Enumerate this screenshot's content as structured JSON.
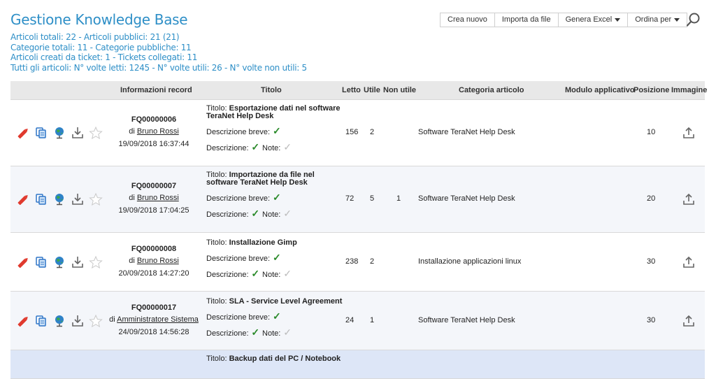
{
  "page": {
    "title": "Gestione Knowledge Base"
  },
  "stats": [
    "Articoli totali: 22 - Articoli pubblici: 21 (21)",
    "Categorie totali: 11 - Categorie pubbliche: 11",
    "Articoli creati da ticket: 1 - Tickets collegati: 11",
    "Tutti gli articoli: N° volte letti: 1245 - N° volte utili: 26 - N° volte non utili: 5"
  ],
  "toolbar": {
    "new_label": "Crea nuovo",
    "import_label": "Importa da file",
    "excel_label": "Genera Excel",
    "sort_label": "Ordina per"
  },
  "table": {
    "headers": {
      "info": "Informazioni record",
      "title": "Titolo",
      "read": "Letto",
      "useful": "Utile",
      "not_useful": "Non utile",
      "category": "Categoria articolo",
      "module": "Modulo applicativo",
      "position": "Posizione",
      "image": "Immagine"
    },
    "labels": {
      "title_prefix": "Titolo:",
      "short_desc": "Descrizione breve:",
      "desc": "Descrizione:",
      "notes": "Note:",
      "by": "di"
    },
    "rows": [
      {
        "code": "FQ00000006",
        "author": "Bruno Rossi",
        "date": "19/09/2018 16:37:44",
        "title": "Esportazione dati nel software TeraNet Help Desk",
        "read": "156",
        "useful": "2",
        "not_useful": "",
        "category": "Software TeraNet Help Desk",
        "position": "10"
      },
      {
        "code": "FQ00000007",
        "author": "Bruno Rossi",
        "date": "19/09/2018 17:04:25",
        "title": "Importazione da file nel software TeraNet Help Desk",
        "read": "72",
        "useful": "5",
        "not_useful": "1",
        "category": "Software TeraNet Help Desk",
        "position": "20"
      },
      {
        "code": "FQ00000008",
        "author": "Bruno Rossi",
        "date": "20/09/2018 14:27:20",
        "title": "Installazione Gimp",
        "read": "238",
        "useful": "2",
        "not_useful": "",
        "category": "Installazione applicazioni linux",
        "position": "30"
      },
      {
        "code": "FQ00000017",
        "author": "Amministratore Sistema",
        "date": "24/09/2018 14:56:28",
        "title": "SLA - Service Level Agreement",
        "read": "24",
        "useful": "1",
        "not_useful": "",
        "category": "Software TeraNet Help Desk",
        "position": "30"
      },
      {
        "title": "Backup dati del PC / Notebook"
      }
    ]
  },
  "colors": {
    "accent": "#2e8fc7",
    "edit": "#e03a2e",
    "check": "#2a8a2a"
  }
}
